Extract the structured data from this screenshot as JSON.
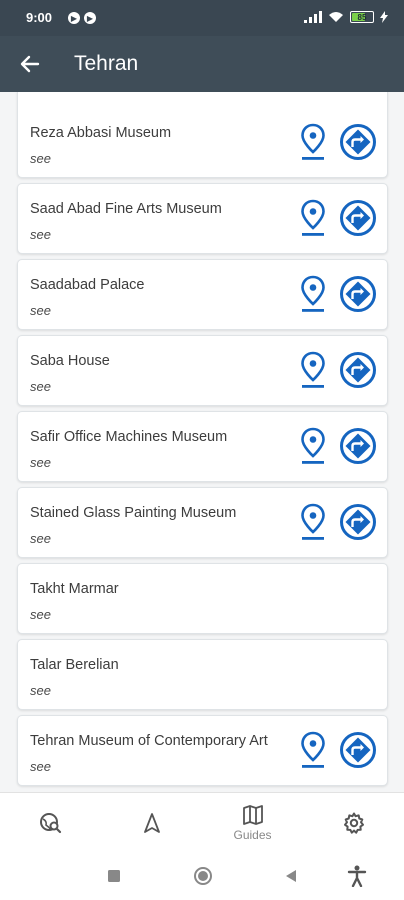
{
  "status": {
    "time": "9:00",
    "left_icons": [
      "notification-icon",
      "notification-icon"
    ],
    "right_icons": [
      "signal-icon",
      "wifi-icon",
      "battery-icon",
      "charging-icon"
    ],
    "battery_level": "85"
  },
  "header": {
    "title": "Tehran",
    "back_icon": "arrow-left-icon"
  },
  "places": [
    {
      "name": "Reza Abbasi Museum",
      "type": "see",
      "has_actions": true
    },
    {
      "name": "Saad Abad Fine Arts Museum",
      "type": "see",
      "has_actions": true
    },
    {
      "name": "Saadabad Palace",
      "type": "see",
      "has_actions": true
    },
    {
      "name": "Saba House",
      "type": "see",
      "has_actions": true
    },
    {
      "name": "Safir Office Machines Museum",
      "type": "see",
      "has_actions": true
    },
    {
      "name": "Stained Glass Painting Museum",
      "type": "see",
      "has_actions": true
    },
    {
      "name": "Takht Marmar",
      "type": "see",
      "has_actions": false
    },
    {
      "name": "Talar Berelian",
      "type": "see",
      "has_actions": false
    },
    {
      "name": "Tehran Museum of Contemporary Art",
      "type": "see",
      "has_actions": true
    }
  ],
  "nav": {
    "items": [
      {
        "icon": "travel-explore-icon",
        "label": ""
      },
      {
        "icon": "navigation-icon",
        "label": ""
      },
      {
        "icon": "map-icon",
        "label": "Guides",
        "active": true
      },
      {
        "icon": "settings-icon",
        "label": ""
      }
    ]
  },
  "colors": {
    "accent": "#1565c0",
    "status_bar": "#3a4752",
    "app_bar": "#3f4d58"
  }
}
